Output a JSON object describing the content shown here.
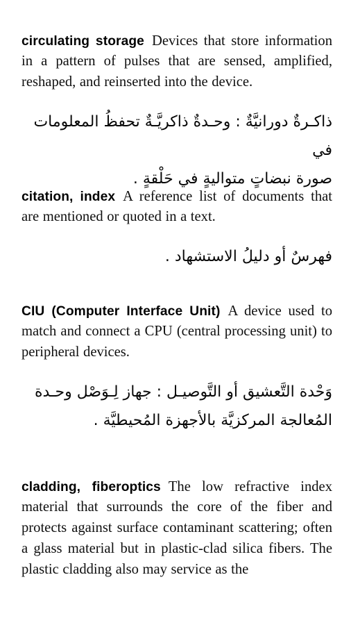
{
  "page": {
    "background_color": "#fefefe",
    "text_color": "#0a0a0a",
    "type": "dictionary-page",
    "language_pair": "English-Arabic"
  },
  "entries": [
    {
      "headword": "circulating storage",
      "definition": "Devices that store information in a pattern of pulses that are sensed, amplified, reshaped, and reinserted into the device.",
      "arabic_lines": [
        "ذاكـرةٌ دورانيَّةٌ : وحـدةٌ ذاكريَّـةٌ تحفظُ المعلومات في",
        "صورة نبضاتٍ متواليةٍ في حَلْقةٍ ."
      ]
    },
    {
      "headword": "citation, index",
      "definition": "A reference list of documents that are mentioned or quoted in a text.",
      "arabic_lines": [
        "فهرسٌ أو دليلُ الاستشهاد ."
      ]
    },
    {
      "headword": "CIU (Computer Interface Unit)",
      "definition": "A device used to match and connect a CPU (central processing unit) to peripheral devices.",
      "arabic_lines": [
        "وَحْدة التَّعشيق أو التَّوصيـل : جهاز لِـوَصْل وحـدة",
        "المُعالجة المركزيَّة بالأجهزة المُحيطيَّة ."
      ]
    },
    {
      "headword": "cladding, fiberoptics",
      "definition": "The low refractive index material that surrounds the core of the fiber and protects against surface contaminant scattering; often a glass material but in plastic-clad silica fibers. The plastic cladding also may service as the",
      "arabic_lines": []
    }
  ]
}
